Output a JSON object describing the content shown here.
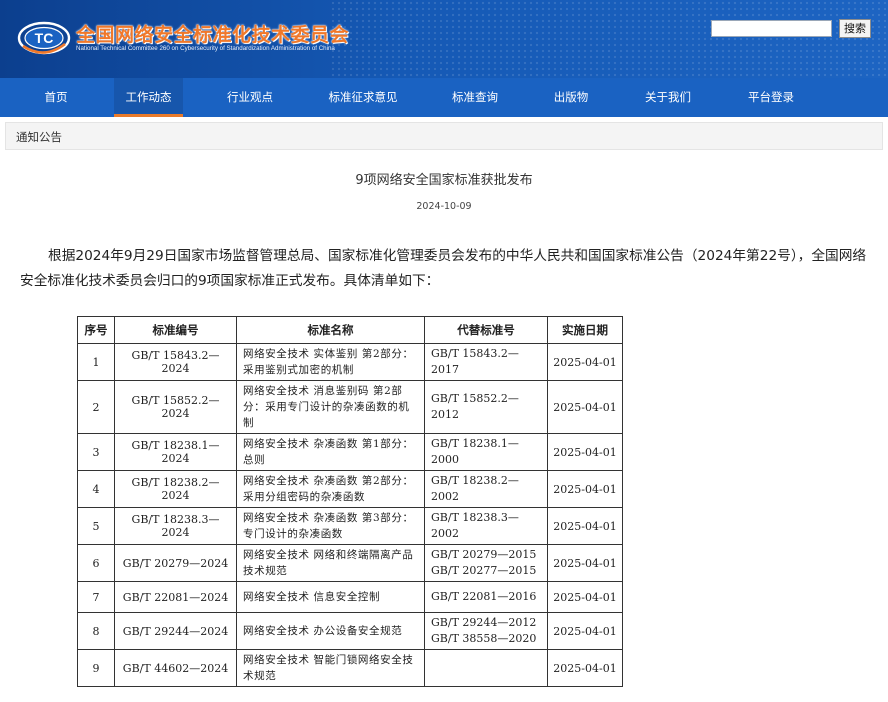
{
  "header": {
    "title": "全国网络安全标准化技术委员会",
    "subtitle": "National Technical Committee 260 on Cybersecurity of Standardization Administration of China",
    "logo_text": "TC",
    "search_placeholder": "",
    "search_button": "搜索"
  },
  "nav": {
    "items": [
      {
        "label": "首页"
      },
      {
        "label": "工作动态",
        "active": true
      },
      {
        "label": "行业观点"
      },
      {
        "label": "标准征求意见"
      },
      {
        "label": "标准查询"
      },
      {
        "label": "出版物"
      },
      {
        "label": "关于我们"
      },
      {
        "label": "平台登录"
      }
    ]
  },
  "breadcrumb": "通知公告",
  "article": {
    "title": "9项网络安全国家标准获批发布",
    "date": "2024-10-09",
    "intro": "根据2024年9月29日国家市场监督管理总局、国家标准化管理委员会发布的中华人民共和国国家标准公告（2024年第22号），全国网络安全标准化技术委员会归口的9项国家标准正式发布。具体清单如下："
  },
  "table": {
    "headers": [
      "序号",
      "标准编号",
      "标准名称",
      "代替标准号",
      "实施日期"
    ],
    "rows": [
      {
        "no": "1",
        "code": "GB/T 15843.2—2024",
        "name": "网络安全技术 实体鉴别 第2部分：采用鉴别式加密的机制",
        "replaces": [
          "GB/T 15843.2—2017"
        ],
        "date": "2025-04-01"
      },
      {
        "no": "2",
        "code": "GB/T 15852.2—2024",
        "name": "网络安全技术 消息鉴别码 第2部分：采用专门设计的杂凑函数的机制",
        "replaces": [
          "GB/T 15852.2—2012"
        ],
        "date": "2025-04-01"
      },
      {
        "no": "3",
        "code": "GB/T 18238.1—2024",
        "name": "网络安全技术 杂凑函数 第1部分：总则",
        "replaces": [
          "GB/T 18238.1—2000"
        ],
        "date": "2025-04-01"
      },
      {
        "no": "4",
        "code": "GB/T 18238.2—2024",
        "name": "网络安全技术 杂凑函数 第2部分：采用分组密码的杂凑函数",
        "replaces": [
          "GB/T 18238.2—2002"
        ],
        "date": "2025-04-01"
      },
      {
        "no": "5",
        "code": "GB/T 18238.3—2024",
        "name": "网络安全技术 杂凑函数 第3部分：专门设计的杂凑函数",
        "replaces": [
          "GB/T 18238.3—2002"
        ],
        "date": "2025-04-01"
      },
      {
        "no": "6",
        "code": "GB/T 20279—2024",
        "name": "网络安全技术 网络和终端隔离产品技术规范",
        "replaces": [
          "GB/T 20279—2015",
          "GB/T 20277—2015"
        ],
        "date": "2025-04-01"
      },
      {
        "no": "7",
        "code": "GB/T 22081—2024",
        "name": "网络安全技术 信息安全控制",
        "replaces": [
          "GB/T 22081—2016"
        ],
        "date": "2025-04-01"
      },
      {
        "no": "8",
        "code": "GB/T 29244—2024",
        "name": "网络安全技术 办公设备安全规范",
        "replaces": [
          "GB/T 29244—2012",
          "GB/T 38558—2020"
        ],
        "date": "2025-04-01"
      },
      {
        "no": "9",
        "code": "GB/T 44602—2024",
        "name": "网络安全技术 智能门锁网络安全技术规范",
        "replaces": [],
        "date": "2025-04-01"
      }
    ]
  },
  "colors": {
    "header_bg": "#1559b5",
    "nav_bg": "#1a62c2",
    "title_orange": "#f0782a",
    "active_underline": "#e87a2a"
  }
}
